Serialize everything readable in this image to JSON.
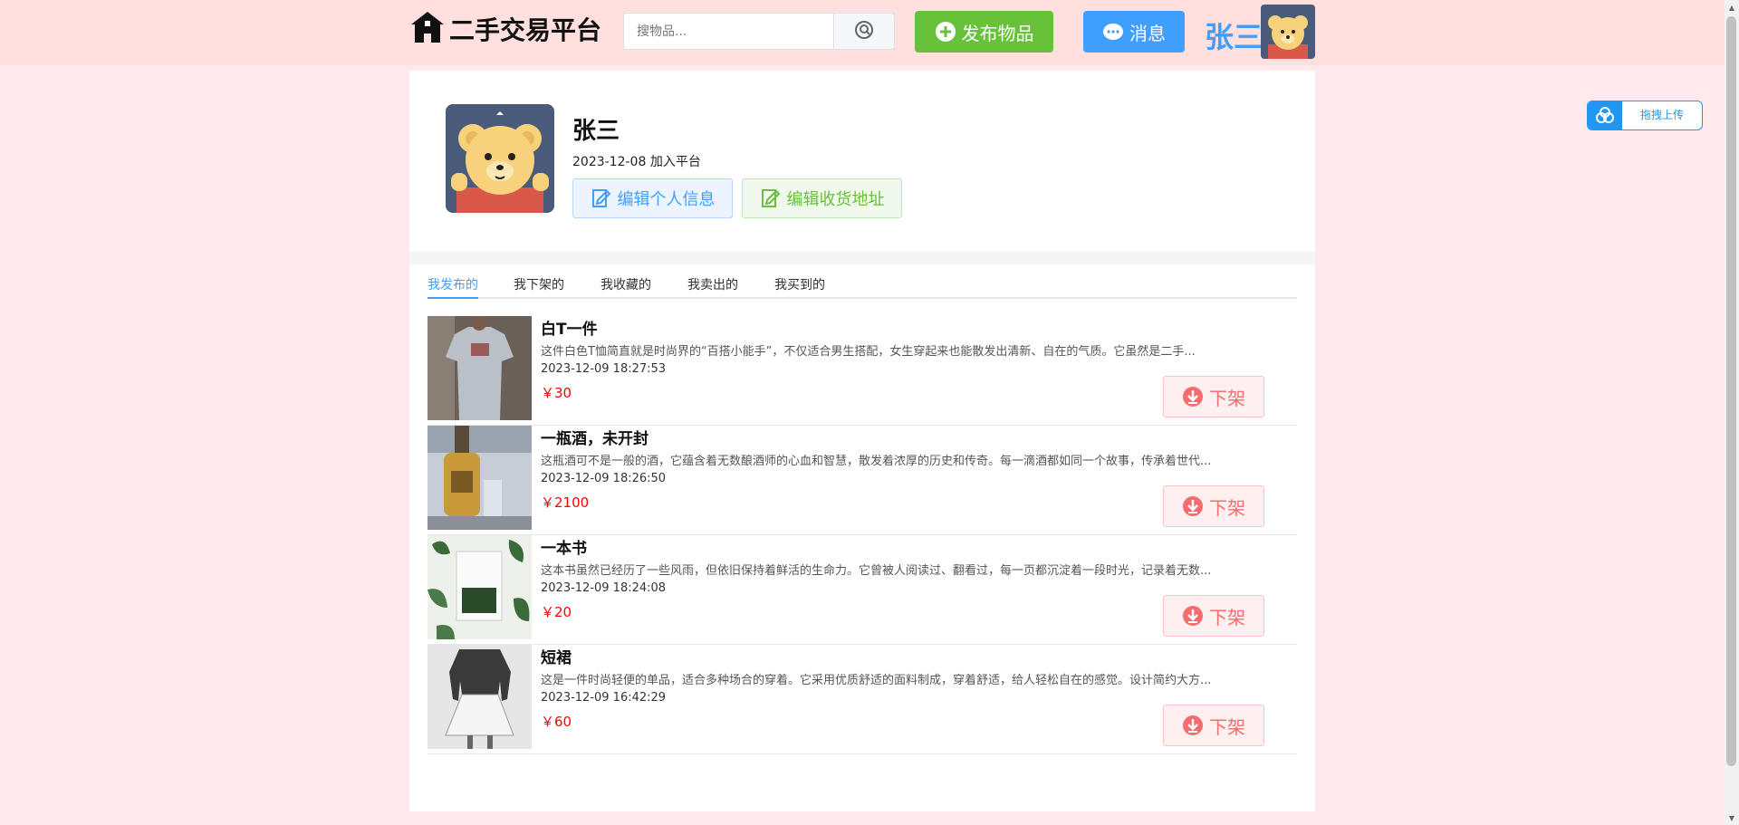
{
  "header": {
    "logo_text": "二手交易平台",
    "search_placeholder": "搜物品...",
    "publish_label": "发布物品",
    "message_label": "消息",
    "username": "张三"
  },
  "profile": {
    "name": "张三",
    "join_date": "2023-12-08",
    "join_suffix": "加入平台",
    "edit_info_label": "编辑个人信息",
    "edit_address_label": "编辑收货地址"
  },
  "tabs": [
    {
      "label": "我发布的",
      "active": true
    },
    {
      "label": "我下架的",
      "active": false
    },
    {
      "label": "我收藏的",
      "active": false
    },
    {
      "label": "我卖出的",
      "active": false
    },
    {
      "label": "我买到的",
      "active": false
    }
  ],
  "items": [
    {
      "title": "白T一件",
      "description": "这件白色T恤简直就是时尚界的“百搭小能手”，不仅适合男生搭配，女生穿起来也能散发出清新、自在的气质。它虽然是二手...",
      "time": "2023-12-09 18:27:53",
      "price": "￥30",
      "action": "下架"
    },
    {
      "title": "一瓶酒，未开封",
      "description": "这瓶酒可不是一般的酒，它蕴含着无数酿酒师的心血和智慧，散发着浓厚的历史和传奇。每一滴酒都如同一个故事，传承着世代...",
      "time": "2023-12-09 18:26:50",
      "price": "￥2100",
      "action": "下架"
    },
    {
      "title": "一本书",
      "description": "这本书虽然已经历了一些风雨，但依旧保持着鲜活的生命力。它曾被人阅读过、翻看过，每一页都沉淀着一段时光，记录着无数...",
      "time": "2023-12-09 18:24:08",
      "price": "￥20",
      "action": "下架"
    },
    {
      "title": "短裙",
      "description": "这是一件时尚轻便的单品，适合多种场合的穿着。它采用优质舒适的面料制成，穿着舒适，给人轻松自在的感觉。设计简约大方...",
      "time": "2023-12-09 16:42:29",
      "price": "￥60",
      "action": "下架"
    }
  ],
  "upload_widget": {
    "label": "拖拽上传"
  },
  "colors": {
    "header_bg": "#ffe0df",
    "page_bg": "#ffe9ec",
    "primary": "#409eff",
    "success": "#67c23a",
    "danger": "#f56c6c",
    "price": "#ff0000"
  },
  "icons": {
    "logo": "house-icon",
    "search": "search-icon",
    "publish": "plus-circle-icon",
    "message": "chat-icon",
    "edit": "edit-document-icon",
    "offshelf": "download-arrow-icon",
    "upload": "cloud-upload-icon"
  }
}
